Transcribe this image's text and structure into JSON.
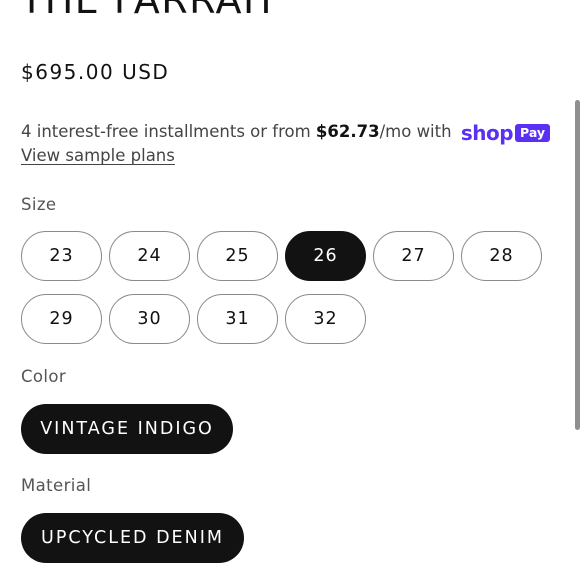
{
  "product": {
    "title": "THE FARRAH",
    "price": "$695.00 USD"
  },
  "installments": {
    "prefix": "4 interest-free installments or from ",
    "amount": "$62.73",
    "suffix": "/mo with",
    "brand_shop": "shop",
    "brand_pay": "Pay",
    "link": "View sample plans"
  },
  "size": {
    "label": "Size",
    "options": [
      "23",
      "24",
      "25",
      "26",
      "27",
      "28",
      "29",
      "30",
      "31",
      "32"
    ],
    "selected": "26"
  },
  "color": {
    "label": "Color",
    "value": "VINTAGE INDIGO"
  },
  "material": {
    "label": "Material",
    "value": "UPCYCLED DENIM"
  },
  "colors": {
    "text": "#121212",
    "muted": "#555555",
    "shop_brand": "#5a31f4",
    "selected_bg": "#121212"
  }
}
